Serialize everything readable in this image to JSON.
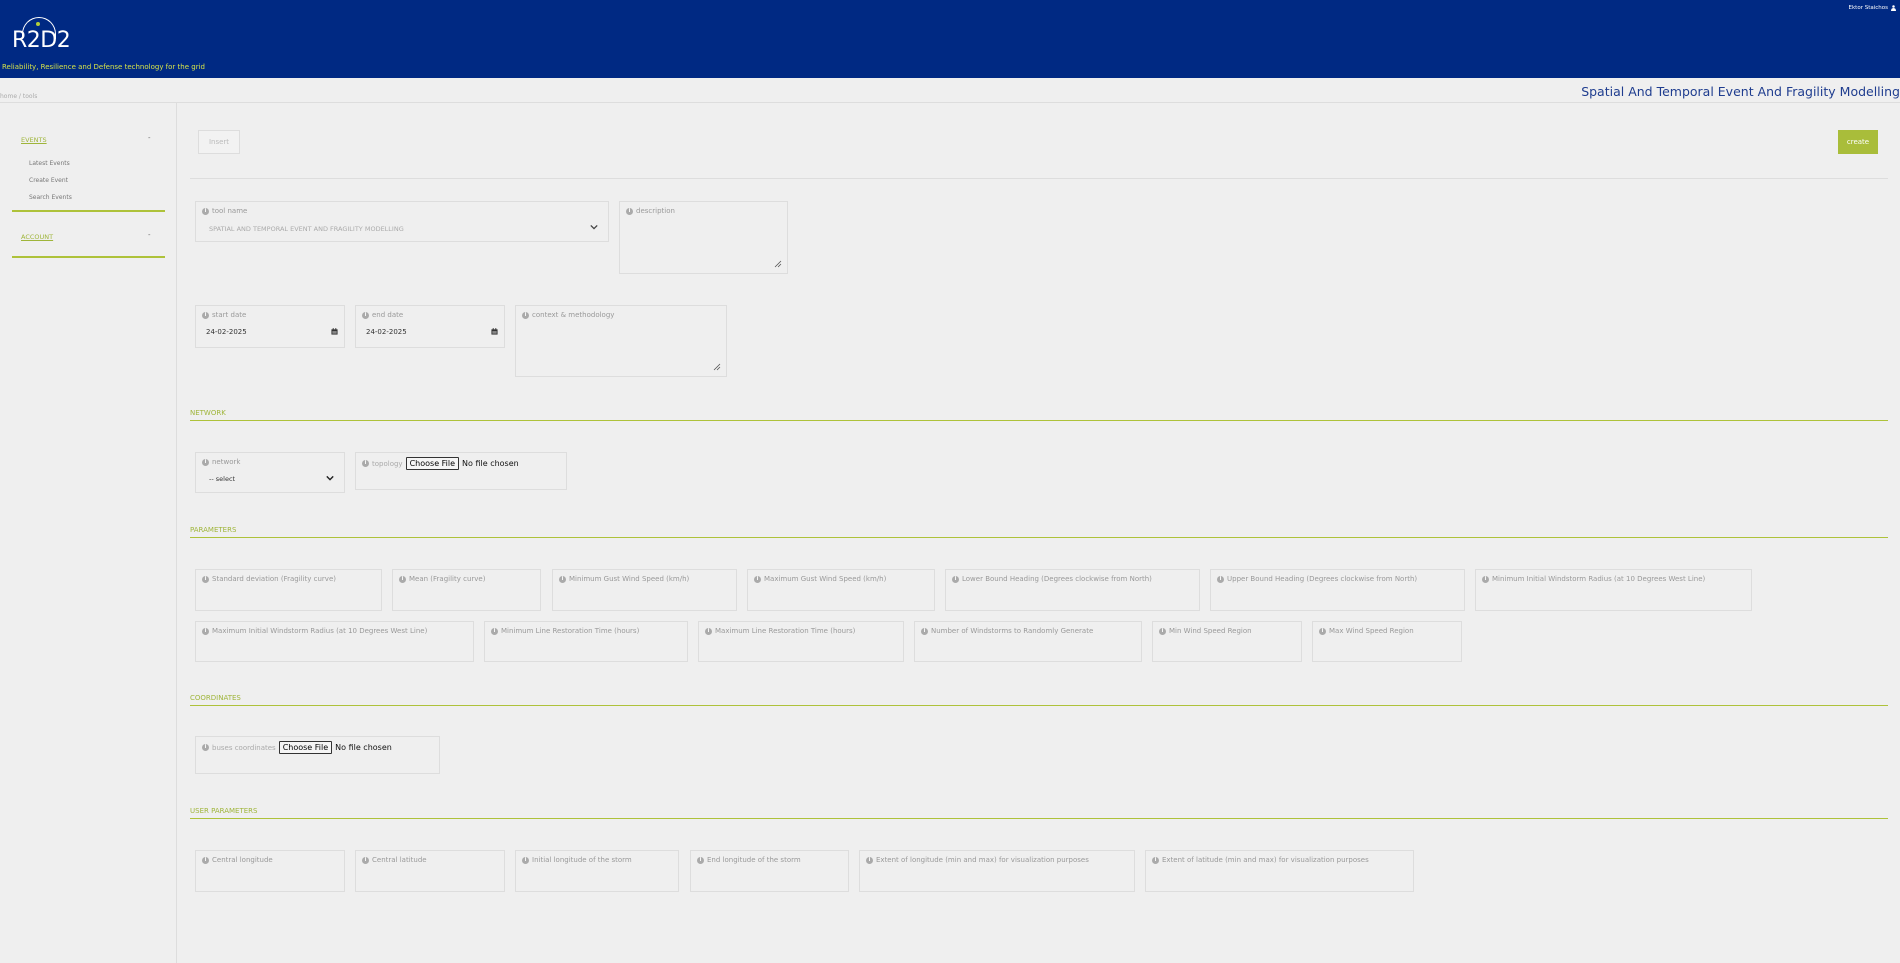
{
  "header": {
    "logo_text": "R2D2",
    "tagline": "Reliability, Resilience and Defense technology for the grid",
    "user_name": "Ektor Staichos"
  },
  "breadcrumb": "home / tools",
  "page_title": "Spatial And Temporal Event And Fragility Modelling",
  "sidebar": {
    "events": {
      "label": "EVENTS",
      "toggle": "-",
      "items": [
        "Latest Events",
        "Create Event",
        "Search Events"
      ]
    },
    "account": {
      "label": "ACCOUNT",
      "toggle": "-"
    }
  },
  "toolbar": {
    "insert_label": "Insert",
    "create_label": "create"
  },
  "form": {
    "tool_name": {
      "label": "tool name",
      "value": "SPATIAL AND TEMPORAL EVENT AND FRAGILITY MODELLING"
    },
    "description": {
      "label": "description"
    },
    "start_date": {
      "label": "start date",
      "value": "24-02-2025"
    },
    "end_date": {
      "label": "end date",
      "value": "24-02-2025"
    },
    "context": {
      "label": "context & methodology"
    }
  },
  "network_section": {
    "title": "NETWORK",
    "network": {
      "label": "network",
      "value": "-- select"
    },
    "topology": {
      "label": "topology",
      "button": "Choose File",
      "status": "No file chosen"
    }
  },
  "parameters_section": {
    "title": "PARAMETERS",
    "fields": [
      "Standard deviation (Fragility curve)",
      "Mean (Fragility curve)",
      "Minimum Gust Wind Speed (km/h)",
      "Maximum Gust Wind Speed (km/h)",
      "Lower Bound Heading (Degrees clockwise from North)",
      "Upper Bound Heading (Degrees clockwise from North)",
      "Minimum Initial Windstorm Radius (at 10 Degrees West Line)",
      "Maximum Initial Windstorm Radius (at 10 Degrees West Line)",
      "Minimum Line Restoration Time (hours)",
      "Maximum Line Restoration Time (hours)",
      "Number of Windstorms to Randomly Generate",
      "Min Wind Speed Region",
      "Max Wind Speed Region"
    ]
  },
  "coordinates_section": {
    "title": "COORDINATES",
    "buses": {
      "label": "buses coordinates",
      "button": "Choose File",
      "status": "No file chosen"
    }
  },
  "user_parameters_section": {
    "title": "USER PARAMETERS",
    "fields": [
      "Central longitude",
      "Central latitude",
      "Initial longitude of the storm",
      "End longitude of the storm",
      "Extent of longitude (min and max) for visualization purposes",
      "Extent of latitude (min and max) for visualization purposes"
    ]
  },
  "colors": {
    "header_bg": "#002983",
    "accent_green": "#a9bd3a",
    "title_blue": "#1f3d8f"
  },
  "icons": [
    "info-icon",
    "chevron-down-icon",
    "calendar-icon",
    "resize-handle-icon",
    "user-icon"
  ]
}
